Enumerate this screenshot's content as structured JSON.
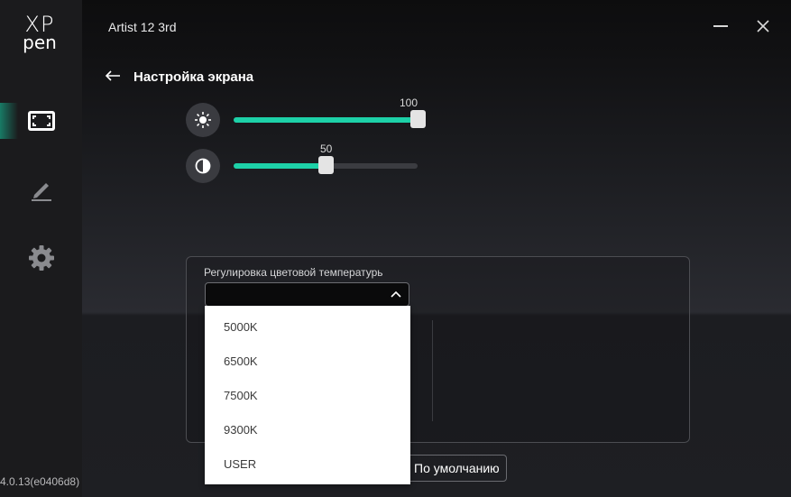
{
  "app": {
    "logo_line1": "XP",
    "logo_line2": "pen",
    "version": "4.0.13(e0406d8)",
    "accent": "#1dd1a8"
  },
  "sidebar": {
    "items": [
      {
        "icon": "screen-frame-icon",
        "active": true
      },
      {
        "icon": "pen-icon",
        "active": false
      },
      {
        "icon": "gear-icon",
        "active": false
      }
    ]
  },
  "window": {
    "title": "Artist 12 3rd",
    "minimize_icon": "minimize-icon",
    "close_icon": "close-icon"
  },
  "page": {
    "back_icon": "back-arrow-icon",
    "title": "Настройка экрана"
  },
  "brightness": {
    "icon": "sun-icon",
    "value": 100,
    "value_label": "100"
  },
  "contrast": {
    "icon": "contrast-icon",
    "value": 50,
    "value_label": "50"
  },
  "color_temperature": {
    "label": "Регулировка цветовой температурь",
    "selected": "",
    "options": [
      "5000K",
      "6500K",
      "7500K",
      "9300K",
      "USER"
    ]
  },
  "reset_button": {
    "label": "По умолчанию"
  }
}
